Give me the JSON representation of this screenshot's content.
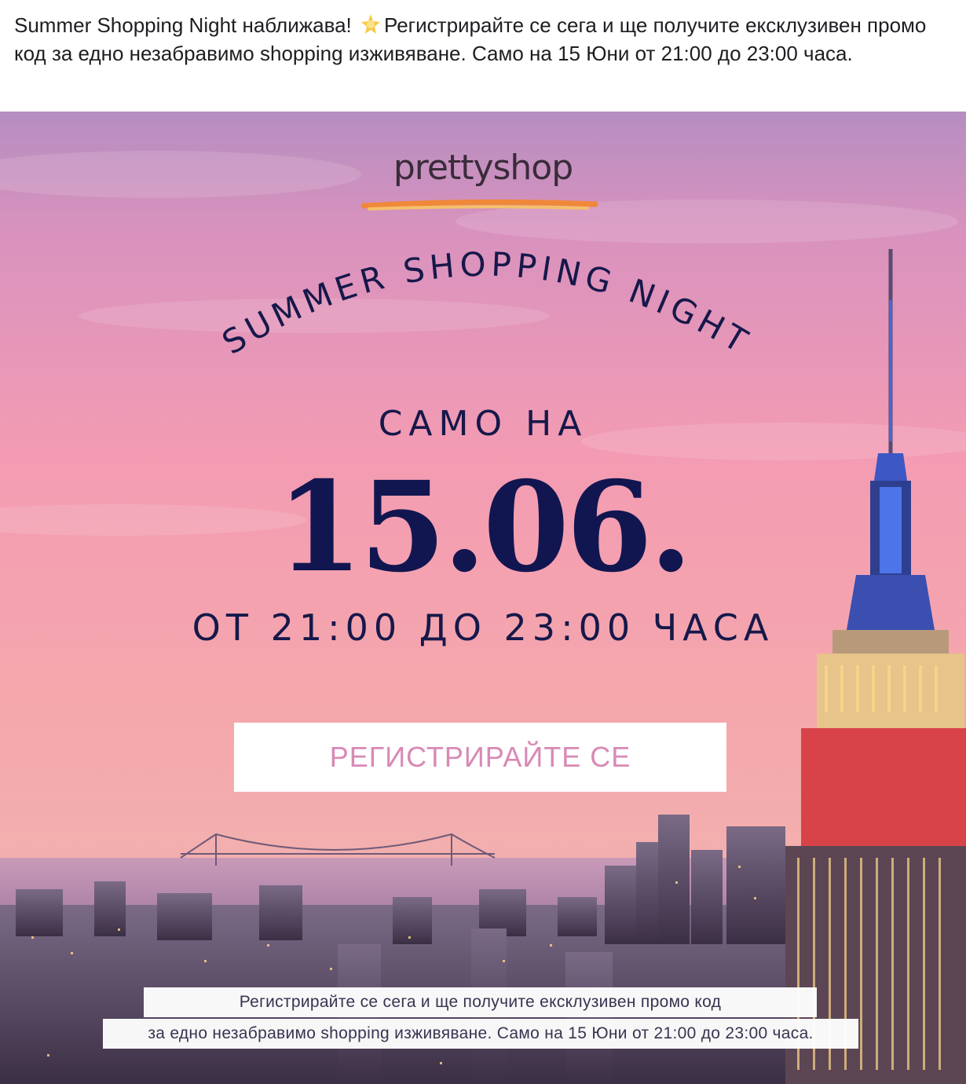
{
  "post": {
    "text_before_emoji": "Summer Shopping Night наближава! ",
    "emoji_icon": "glowing-star-icon",
    "text_after_emoji": "Регистрирайте се сега и ще получите ексклузивен промо код за едно незабравимо shopping изживяване. Само на 15 Юни от 21:00 до 23:00 часа."
  },
  "banner": {
    "logo": "prettyshop",
    "arc_title": "SUMMER SHOPPING NIGHT",
    "samo_na": "САМО НА",
    "date": "15.06.",
    "time_range": "ОТ 21:00 ДО 23:00 ЧАСА",
    "cta_label": "РЕГИСТРИРАЙТЕ СЕ",
    "caption_line_1": "Регистрирайте се сега и ще получите  ексклузивен промо код",
    "caption_line_2": "за едно незабравимо shopping изживяване. Само на 15 Юни от 21:00 до 23:00 часа.",
    "colors": {
      "sky_top": "#c98bb8",
      "sky_mid": "#f39fb0",
      "sky_low": "#f5b0a6",
      "title_navy": "#16184a",
      "cta_text_pink": "#d989b5",
      "logo_stroke_orange": "#f0883a"
    }
  }
}
